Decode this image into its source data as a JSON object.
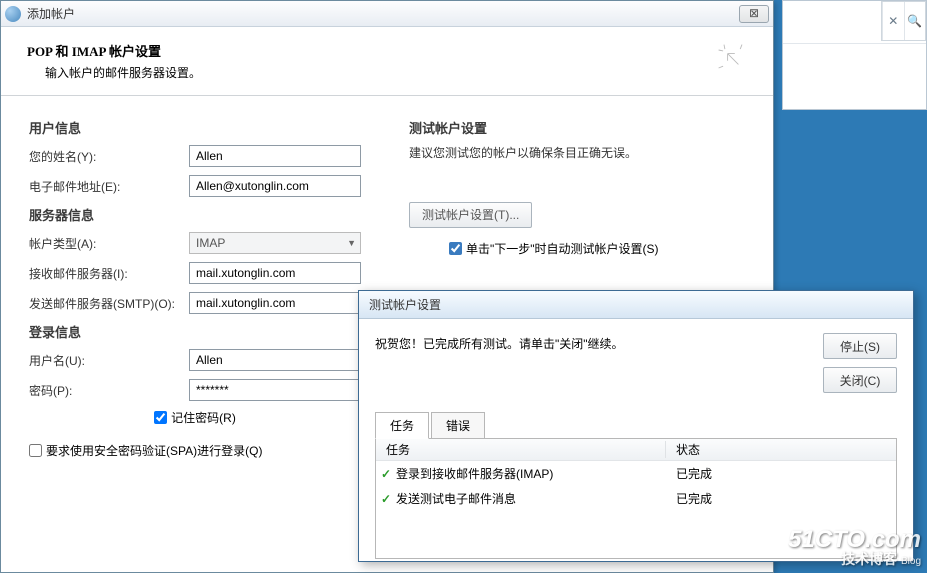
{
  "main": {
    "title": "添加帐户",
    "header_title": "POP 和 IMAP 帐户设置",
    "header_sub": "输入帐户的邮件服务器设置。"
  },
  "user_section": {
    "heading": "用户信息",
    "name_label": "您的姓名(Y):",
    "name_value": "Allen",
    "email_label": "电子邮件地址(E):",
    "email_value": "Allen@xutonglin.com"
  },
  "server_section": {
    "heading": "服务器信息",
    "type_label": "帐户类型(A):",
    "type_value": "IMAP",
    "incoming_label": "接收邮件服务器(I):",
    "incoming_value": "mail.xutonglin.com",
    "outgoing_label": "发送邮件服务器(SMTP)(O):",
    "outgoing_value": "mail.xutonglin.com"
  },
  "login_section": {
    "heading": "登录信息",
    "user_label": "用户名(U):",
    "user_value": "Allen",
    "pass_label": "密码(P):",
    "pass_value": "*******",
    "remember_label": "记住密码(R)",
    "spa_label": "要求使用安全密码验证(SPA)进行登录(Q)"
  },
  "test_section": {
    "heading": "测试帐户设置",
    "info": "建议您测试您的帐户以确保条目正确无误。",
    "btn": "测试帐户设置(T)...",
    "auto_label": "单击\"下一步\"时自动测试帐户设置(S)"
  },
  "test_dialog": {
    "title": "测试帐户设置",
    "message": "祝贺您！已完成所有测试。请单击\"关闭\"继续。",
    "stop": "停止(S)",
    "close": "关闭(C)",
    "tab_tasks": "任务",
    "tab_errors": "错误",
    "col_task": "任务",
    "col_status": "状态",
    "rows": [
      {
        "task": "登录到接收邮件服务器(IMAP)",
        "status": "已完成"
      },
      {
        "task": "发送测试电子邮件消息",
        "status": "已完成"
      }
    ]
  },
  "watermark": {
    "l1": "51CTO.com",
    "l2": "技术博客",
    "blog": "Blog"
  }
}
